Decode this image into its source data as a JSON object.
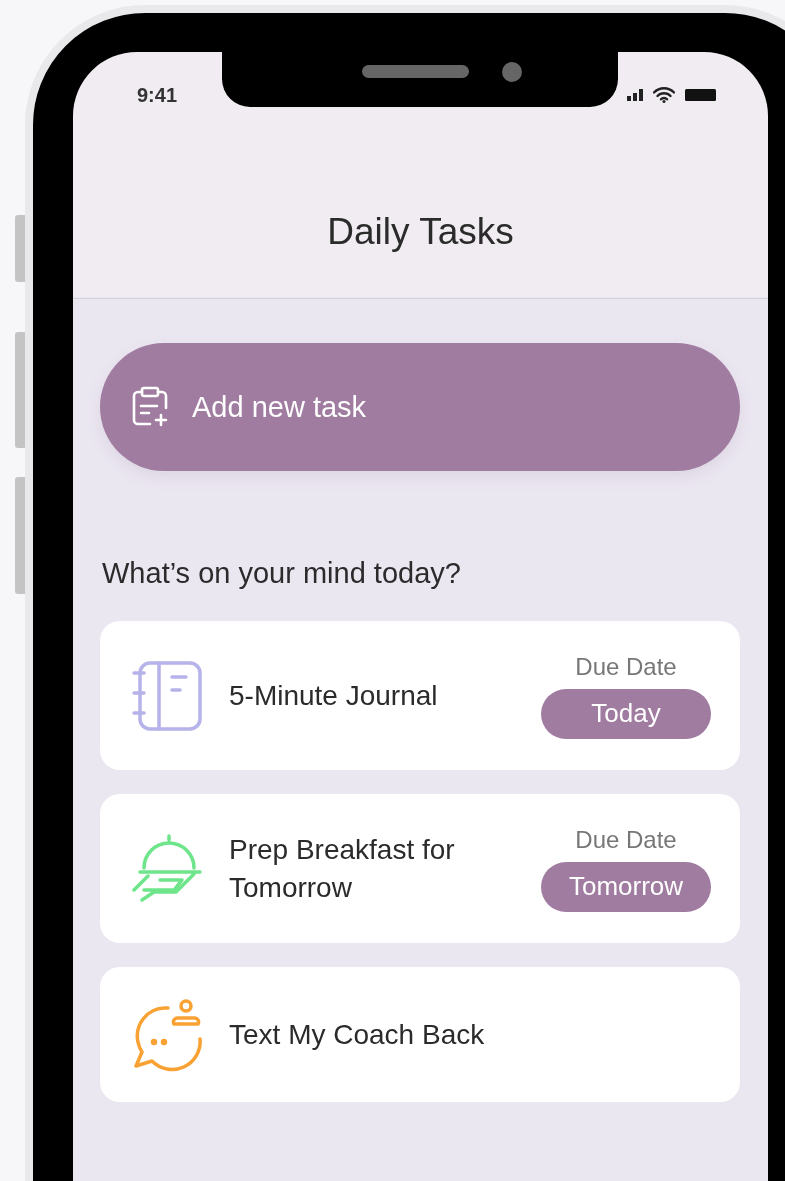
{
  "status_bar": {
    "time": "9:41"
  },
  "header": {
    "title": "Daily Tasks"
  },
  "add_button": {
    "label": "Add new task"
  },
  "section_heading": "What’s on your mind today?",
  "tasks": [
    {
      "title": "5-Minute Journal",
      "due_label": "Due Date",
      "due": "Today"
    },
    {
      "title": "Prep Breakfast for Tomorrow",
      "due_label": "Due Date",
      "due": "Tomorrow"
    },
    {
      "title": "Text My Coach Back"
    }
  ]
}
